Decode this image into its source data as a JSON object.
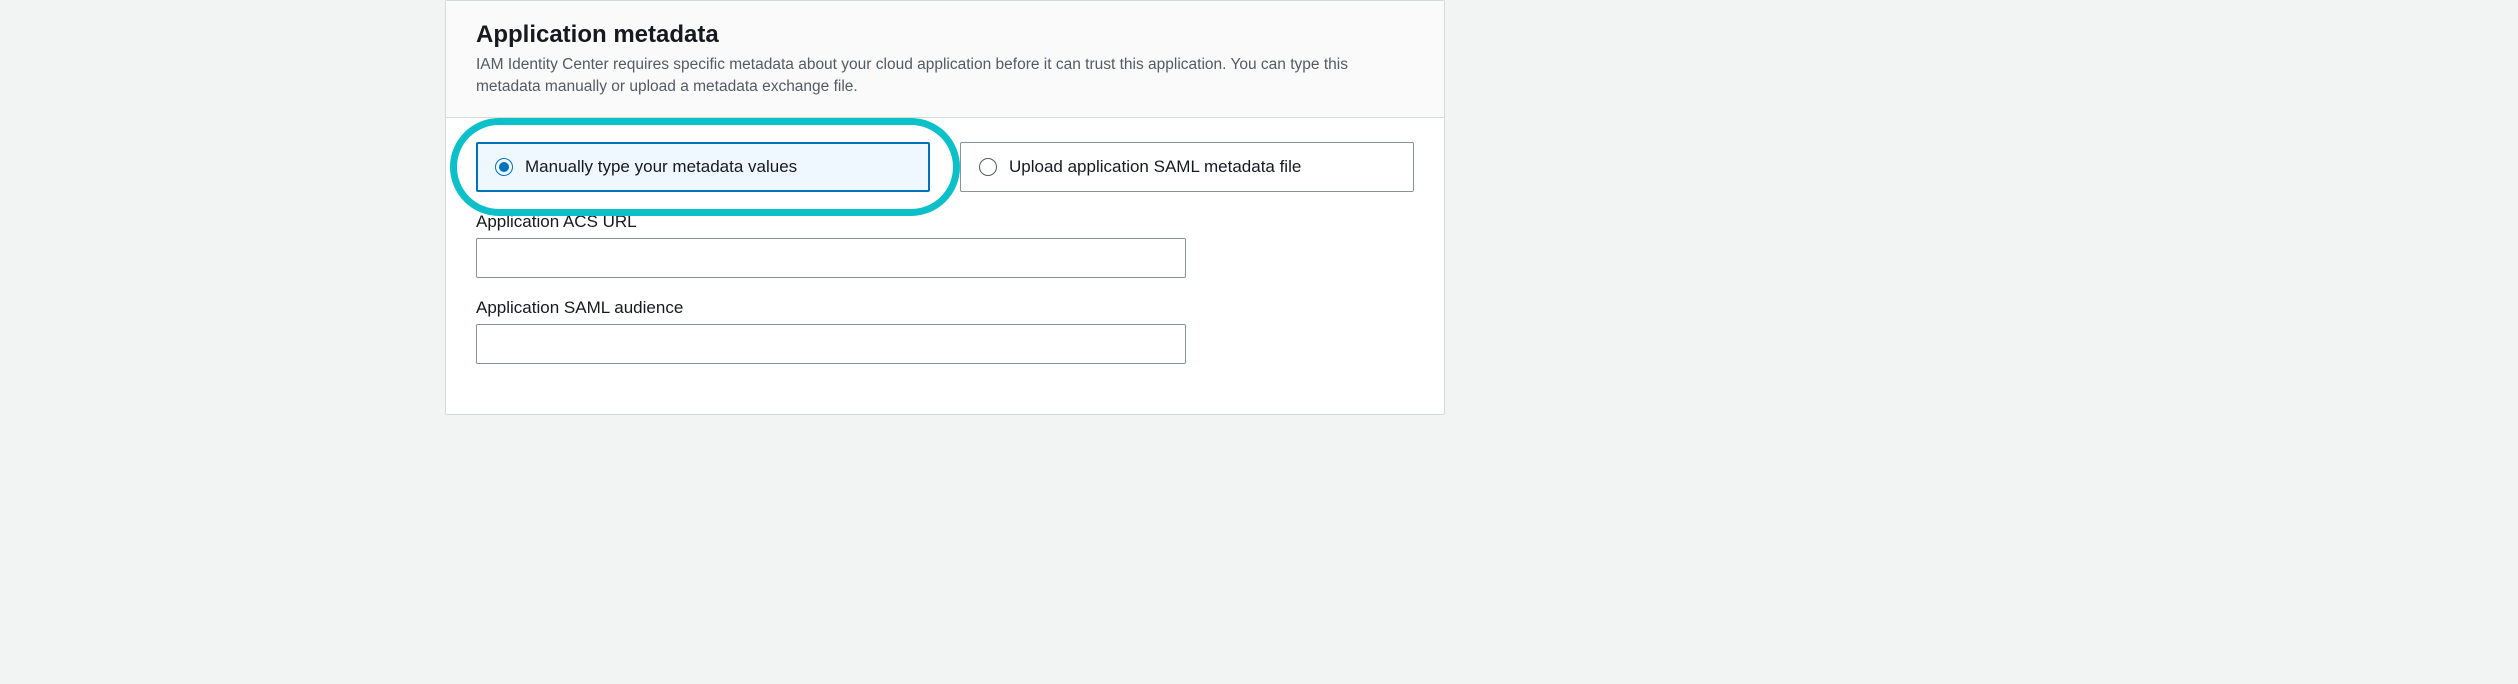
{
  "panel": {
    "title": "Application metadata",
    "description": "IAM Identity Center requires specific metadata about your cloud application before it can trust this application. You can type this metadata manually or upload a metadata exchange file."
  },
  "options": {
    "manual": {
      "label": "Manually type your metadata values",
      "selected": true
    },
    "upload": {
      "label": "Upload application SAML metadata file",
      "selected": false
    }
  },
  "fields": {
    "acs_url": {
      "label": "Application ACS URL",
      "value": ""
    },
    "saml_audience": {
      "label": "Application SAML audience",
      "value": ""
    }
  },
  "colors": {
    "highlight": "#0bc0c8",
    "primary": "#0073bb",
    "border": "#879596"
  }
}
